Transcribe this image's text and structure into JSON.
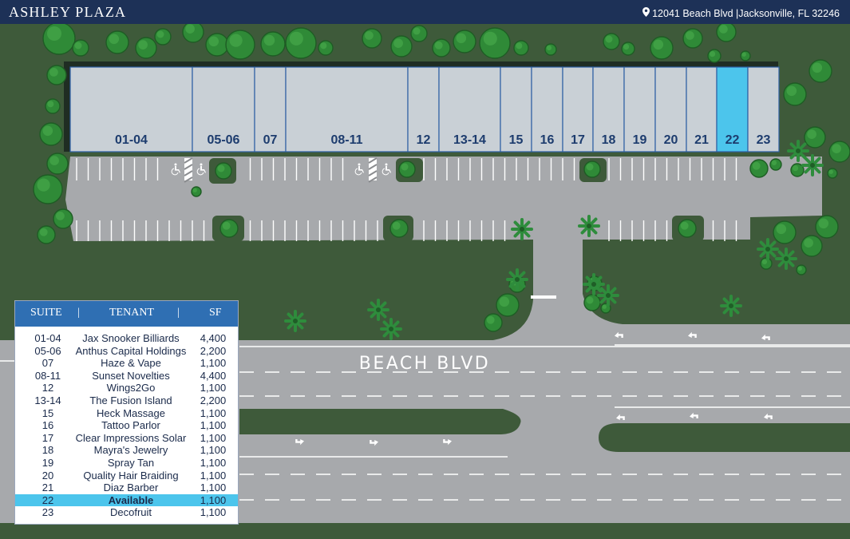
{
  "header": {
    "title": "ASHLEY PLAZA",
    "address": "12041 Beach Blvd |Jacksonville, FL 32246"
  },
  "colors": {
    "header_bg": "#1d3157",
    "grass": "#3e5a3a",
    "asphalt": "#a7a9ac",
    "building": "#c9d0d6",
    "available_highlight": "#4cc5ec",
    "legend_header": "#2f6fb3"
  },
  "units": [
    {
      "label": "01-04",
      "available": false
    },
    {
      "label": "05-06",
      "available": false
    },
    {
      "label": "07",
      "available": false
    },
    {
      "label": "08-11",
      "available": false
    },
    {
      "label": "12",
      "available": false
    },
    {
      "label": "13-14",
      "available": false
    },
    {
      "label": "15",
      "available": false
    },
    {
      "label": "16",
      "available": false
    },
    {
      "label": "17",
      "available": false
    },
    {
      "label": "18",
      "available": false
    },
    {
      "label": "19",
      "available": false
    },
    {
      "label": "20",
      "available": false
    },
    {
      "label": "21",
      "available": false
    },
    {
      "label": "22",
      "available": true
    },
    {
      "label": "23",
      "available": false
    }
  ],
  "road": {
    "name": "BEACH BLVD"
  },
  "legend": {
    "headers": {
      "suite": "SUITE",
      "tenant": "TENANT",
      "sf": "SF",
      "separator": "|"
    },
    "rows": [
      {
        "suite": "01-04",
        "tenant": "Jax Snooker Billiards",
        "sf": "4,400"
      },
      {
        "suite": "05-06",
        "tenant": "Anthus Capital Holdings",
        "sf": "2,200"
      },
      {
        "suite": "07",
        "tenant": "Haze & Vape",
        "sf": "1,100"
      },
      {
        "suite": "08-11",
        "tenant": "Sunset Novelties",
        "sf": "4,400"
      },
      {
        "suite": "12",
        "tenant": "Wings2Go",
        "sf": "1,100"
      },
      {
        "suite": "13-14",
        "tenant": "The Fusion Island",
        "sf": "2,200"
      },
      {
        "suite": "15",
        "tenant": "Heck Massage",
        "sf": "1,100"
      },
      {
        "suite": "16",
        "tenant": "Tattoo Parlor",
        "sf": "1,100"
      },
      {
        "suite": "17",
        "tenant": "Clear Impressions Solar",
        "sf": "1,100"
      },
      {
        "suite": "18",
        "tenant": "Mayra's Jewelry",
        "sf": "1,100"
      },
      {
        "suite": "19",
        "tenant": "Spray Tan",
        "sf": "1,100"
      },
      {
        "suite": "20",
        "tenant": "Quality Hair Braiding",
        "sf": "1,100"
      },
      {
        "suite": "21",
        "tenant": "Diaz Barber",
        "sf": "1,100"
      },
      {
        "suite": "22",
        "tenant": "Available",
        "sf": "1,100",
        "available": true
      },
      {
        "suite": "23",
        "tenant": "Decofruit",
        "sf": "1,100"
      }
    ]
  },
  "icons": {
    "location": "map-pin-icon",
    "accessible_parking": "wheelchair-icon",
    "turn_arrow": "turn-arrow-icon",
    "tree": "tree-icon",
    "palm": "palm-icon"
  }
}
